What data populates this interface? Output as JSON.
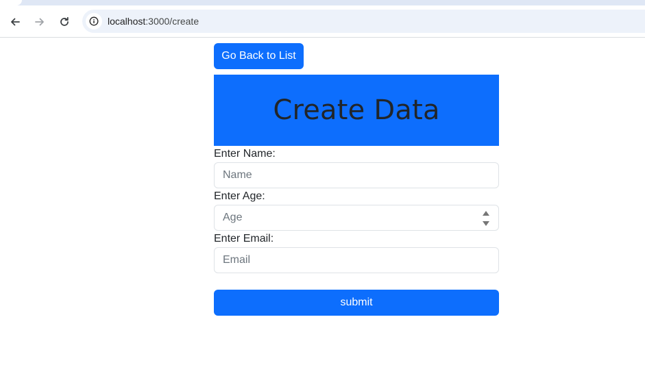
{
  "browser": {
    "url_host": "localhost",
    "url_path": ":3000/create",
    "icons": {
      "back": "arrow-left-icon",
      "forward": "arrow-right-icon",
      "reload": "reload-icon",
      "site_info": "info-icon"
    }
  },
  "page": {
    "back_button_label": "Go Back to List",
    "title": "Create Data",
    "form": {
      "name_label": "Enter Name:",
      "name_placeholder": "Name",
      "age_label": "Enter Age:",
      "age_placeholder": "Age",
      "email_label": "Enter Email:",
      "email_placeholder": "Email",
      "submit_label": "submit"
    }
  },
  "colors": {
    "primary": "#0d6efd",
    "title_text": "#212529",
    "placeholder": "#6c757d"
  }
}
